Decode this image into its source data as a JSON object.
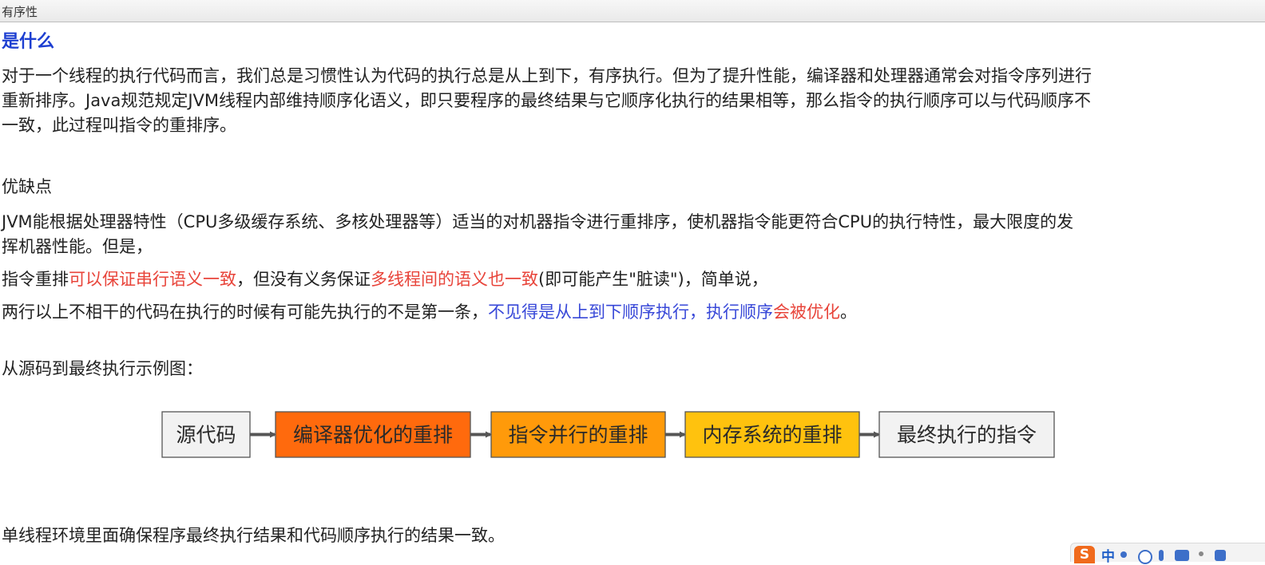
{
  "window": {
    "title": "有序性"
  },
  "section1": {
    "heading": "是什么",
    "para_line1": "对于一个线程的执行代码而言，我们总是习惯性认为代码的执行总是从上到下，有序执行。但为了提升性能，编译器和处理器通常会对指令序列进行",
    "para_line2": "重新排序。Java规范规定JVM线程内部维持顺序化语义，即只要程序的最终结果与它顺序化执行的结果相等，那么指令的执行顺序可以与代码顺序不",
    "para_line3": "一致，此过程叫指令的重排序。"
  },
  "section2": {
    "heading": "优缺点",
    "para_line1": "JVM能根据处理器特性（CPU多级缓存系统、多核处理器等）适当的对机器指令进行重排序，使机器指令能更符合CPU的执行特性，最大限度的发",
    "para_line2": "挥机器性能。但是，",
    "line3": {
      "part1": "指令重排",
      "part2_red": "可以保证串行语义一致",
      "part3": "，但没有义务保证",
      "part4_red": "多线程间的语义也一致",
      "part5": "(即可能产生\"脏读\")，简单说，"
    },
    "line4": {
      "part1": "两行以上不相干的代码在执行的时候有可能先执行的不是第一条，",
      "part2_blue": "不见得是从上到下顺序执行，执行顺序",
      "part3_red": "会被优化",
      "part4": "。"
    }
  },
  "section3": {
    "caption": "从源码到最终执行示例图："
  },
  "flow": {
    "steps": [
      {
        "label": "源代码",
        "fill": "#f2f2f2"
      },
      {
        "label": "编译器优化的重排",
        "fill": "#ff6a0d"
      },
      {
        "label": "指令并行的重排",
        "fill": "#ff9a0a"
      },
      {
        "label": "内存系统的重排",
        "fill": "#ffc20e"
      },
      {
        "label": "最终执行的指令",
        "fill": "#f2f2f2"
      }
    ],
    "arrow_color": "#555555",
    "border_color": "#555555"
  },
  "footer": {
    "sentence": "单线程环境里面确保程序最终执行结果和代码顺序执行的结果一致。"
  },
  "ime": {
    "logo_text": "S",
    "mode_label": "中"
  }
}
